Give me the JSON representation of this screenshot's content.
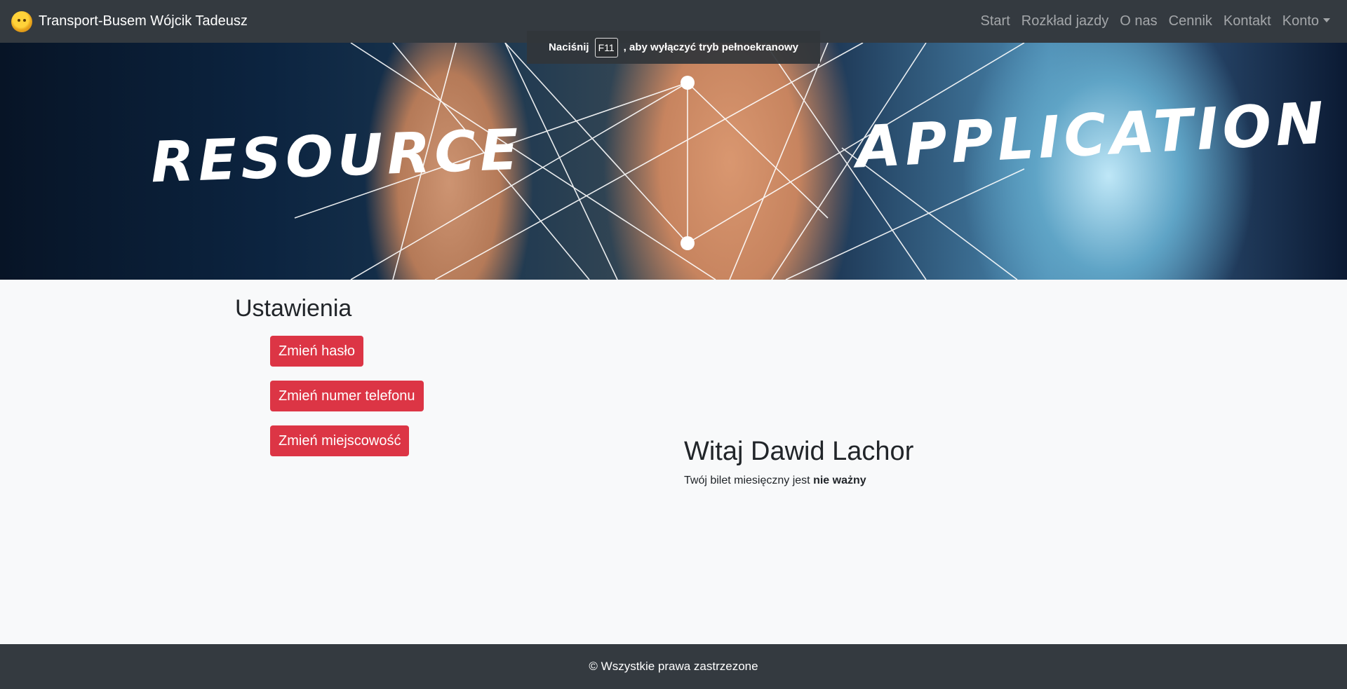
{
  "navbar": {
    "brand": "Transport-Busem Wójcik Tadeusz",
    "links": [
      "Start",
      "Rozkład jazdy",
      "O nas",
      "Cennik",
      "Kontakt",
      "Konto"
    ]
  },
  "hero": {
    "words": [
      "RESOURCE",
      "APPLICATION"
    ]
  },
  "fullscreen_tip": {
    "prefix": "Naciśnij",
    "key": "F11",
    "suffix": ", aby wyłączyć tryb pełnoekranowy"
  },
  "settings": {
    "title": "Ustawienia",
    "buttons": [
      "Zmień hasło",
      "Zmień numer telefonu",
      "Zmień miejscowość"
    ]
  },
  "welcome": {
    "title": "Witaj Dawid Lachor",
    "ticket_prefix": "Twój bilet miesięczny jest",
    "ticket_status": "nie ważny"
  },
  "footer": {
    "text": "© Wszystkie prawa zastrzezone"
  },
  "colors": {
    "navbar": "#343a40",
    "danger": "#dc3545",
    "background": "#f8f9fa"
  }
}
